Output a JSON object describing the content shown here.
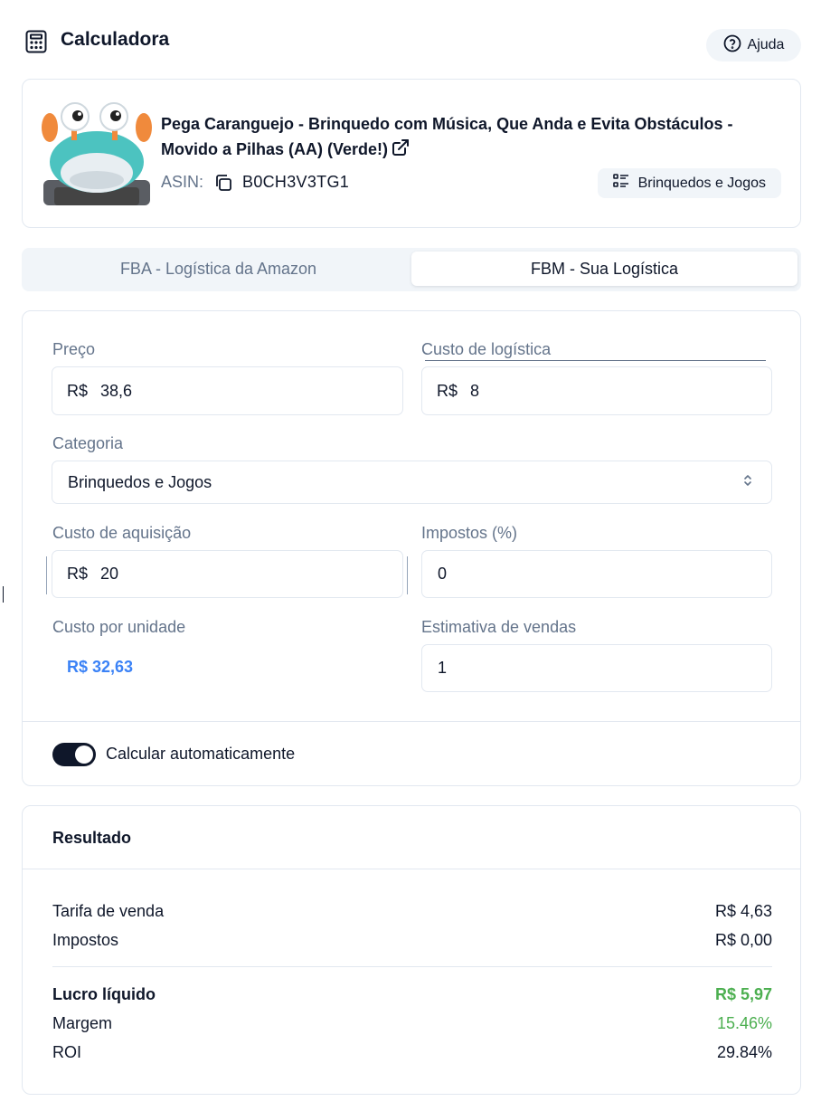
{
  "header": {
    "title": "Calculadora",
    "help_label": "Ajuda"
  },
  "product": {
    "title": "Pega Caranguejo - Brinquedo com Música, Que Anda e Evita Obstáculos - Movido a Pilhas (AA) (Verde!)",
    "asin_label": "ASIN:",
    "asin": "B0CH3V3TG1",
    "category_badge": "Brinquedos e Jogos"
  },
  "tabs": {
    "fba": "FBA - Logística da Amazon",
    "fbm": "FBM - Sua Logística",
    "active": "fbm"
  },
  "form": {
    "price_label": "Preço",
    "price_prefix": "R$",
    "price_value": "38,6",
    "logistics_label": "Custo de logística",
    "logistics_prefix": "R$",
    "logistics_value": "8",
    "category_label": "Categoria",
    "category_value": "Brinquedos e Jogos",
    "acquisition_label": "Custo de aquisição",
    "acquisition_prefix": "R$",
    "acquisition_value": "20",
    "taxes_label": "Impostos (%)",
    "taxes_value": "0",
    "unit_cost_label": "Custo por unidade",
    "unit_cost_value": "R$ 32,63",
    "sales_label": "Estimativa de vendas",
    "sales_value": "1",
    "auto_calc_label": "Calcular automaticamente",
    "auto_calc_on": true
  },
  "result": {
    "title": "Resultado",
    "sale_fee_label": "Tarifa de venda",
    "sale_fee_value": "R$ 4,63",
    "taxes_label": "Impostos",
    "taxes_value": "R$ 0,00",
    "net_profit_label": "Lucro líquido",
    "net_profit_value": "R$ 5,97",
    "margin_label": "Margem",
    "margin_value": "15.46%",
    "roi_label": "ROI",
    "roi_value": "29.84%"
  },
  "colors": {
    "accent_blue": "#3b82f6",
    "profit_green": "#4caf50",
    "dark": "#0f172a",
    "muted": "#64748b"
  }
}
